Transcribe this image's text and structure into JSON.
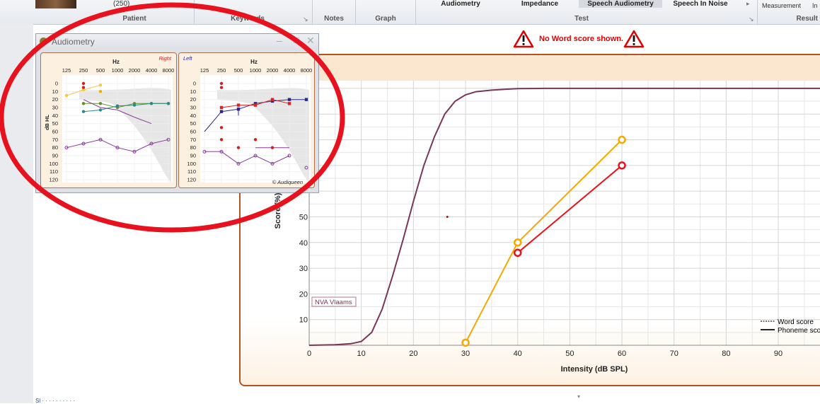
{
  "ribbon": {
    "patient_count": "(250)",
    "groups": {
      "patient": "Patient",
      "keywords": "Keywords",
      "notes": "Notes",
      "graph": "Graph",
      "test": "Test",
      "result": "Result"
    },
    "tabs": [
      "Audiometry",
      "Impedance",
      "Speech Audiometry",
      "Speech In Noise"
    ],
    "active_tab": "Speech Audiometry",
    "result_items": {
      "measurement": "Measurement",
      "in": "In"
    }
  },
  "warning": {
    "text": "No Word score shown."
  },
  "audiometry_window": {
    "title": "Audiometry",
    "right_panel": {
      "side": "Right",
      "hz_label": "Hz",
      "freqs": [
        "125",
        "250",
        "500",
        "1000",
        "2000",
        "4000",
        "8000"
      ],
      "levels": [
        "0",
        "10",
        "20",
        "30",
        "40",
        "50",
        "60",
        "70",
        "80",
        "90",
        "100",
        "110",
        "120"
      ],
      "ylabel": "dB HL"
    },
    "left_panel": {
      "side": "Left",
      "hz_label": "Hz",
      "freqs": [
        "125",
        "250",
        "500",
        "1000",
        "2000",
        "4000",
        "8000"
      ],
      "levels": [
        "0",
        "10",
        "20",
        "30",
        "40",
        "50",
        "60",
        "70",
        "80",
        "90",
        "100",
        "110",
        "120"
      ],
      "copyright": "© Audiqueen"
    },
    "colors": {
      "right": "#cc2222",
      "left": "#2222aa"
    }
  },
  "chart_data": {
    "type": "line",
    "xlabel": "Intensity (dB SPL)",
    "ylabel": "Score (%)",
    "x_ticks": [
      0,
      10,
      20,
      30,
      40,
      50,
      60,
      70,
      80,
      90
    ],
    "y_ticks": [
      10,
      20,
      30,
      40,
      50
    ],
    "xlim": [
      0,
      98
    ],
    "ylim": [
      0,
      103
    ],
    "grid": true,
    "norm_curve": {
      "label": "NVA Vlaams",
      "color": "#7a3558",
      "x": [
        0,
        5,
        8,
        10,
        12,
        14,
        16,
        18,
        20,
        22,
        24,
        26,
        28,
        30,
        32,
        35,
        38,
        40,
        45,
        50,
        60,
        80,
        98
      ],
      "y": [
        0,
        0.2,
        0.6,
        1.5,
        5,
        14,
        27,
        41,
        56,
        70,
        81,
        90,
        95,
        97.5,
        98.7,
        99.3,
        99.7,
        99.9,
        100,
        100,
        100,
        100,
        100
      ]
    },
    "series": [
      {
        "color": "#f5a800",
        "x": [
          30,
          40,
          60
        ],
        "y": [
          1,
          40,
          80
        ]
      },
      {
        "color": "#e8121e",
        "x": [
          40,
          60
        ],
        "y": [
          36,
          70
        ]
      }
    ],
    "stray_point": {
      "x": 26.5,
      "y": 50,
      "color": "#cc0000"
    },
    "legend": {
      "items": [
        "Word score",
        "Phoneme score"
      ],
      "placement": "right"
    },
    "title": ""
  }
}
